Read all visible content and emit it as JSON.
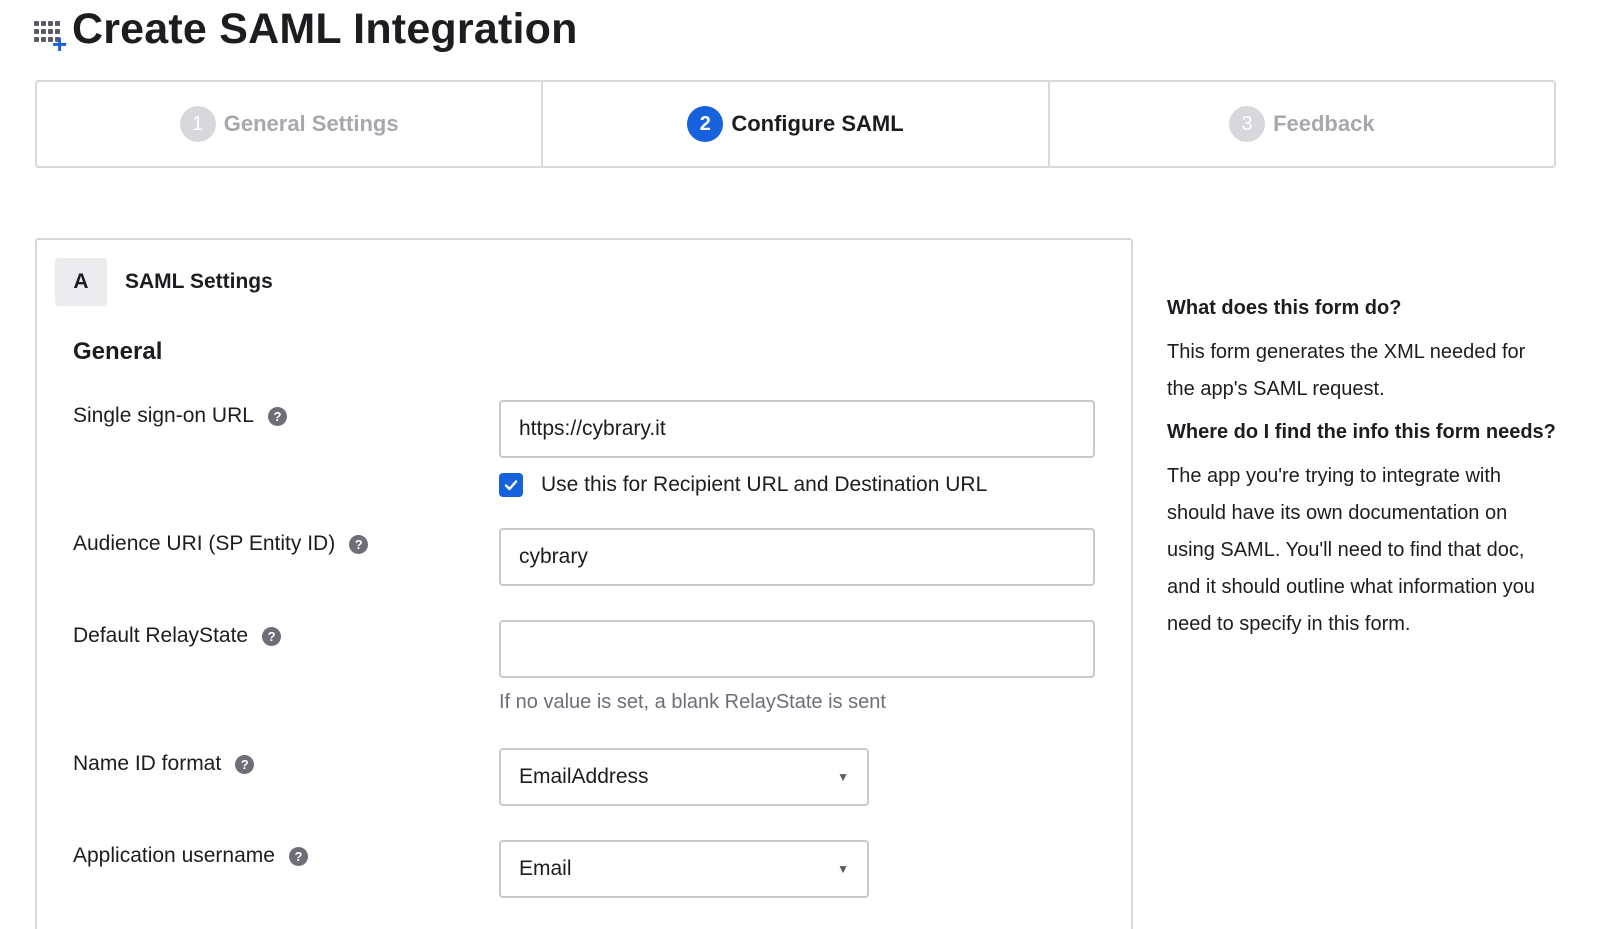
{
  "header": {
    "icon": "app-add-icon",
    "title": "Create SAML Integration"
  },
  "stepper": {
    "steps": [
      {
        "number": "1",
        "label": "General Settings",
        "state": "inactive"
      },
      {
        "number": "2",
        "label": "Configure SAML",
        "state": "active"
      },
      {
        "number": "3",
        "label": "Feedback",
        "state": "inactive"
      }
    ]
  },
  "section": {
    "letter": "A",
    "title": "SAML Settings",
    "group_title": "General"
  },
  "fields": {
    "sso_url": {
      "label": "Single sign-on URL",
      "value": "https://cybrary.it"
    },
    "recipient_checkbox": {
      "label": "Use this for Recipient URL and Destination URL",
      "checked": true
    },
    "audience_uri": {
      "label": "Audience URI (SP Entity ID)",
      "value": "cybrary"
    },
    "relay_state": {
      "label": "Default RelayState",
      "value": "",
      "hint": "If no value is set, a blank RelayState is sent"
    },
    "name_id_format": {
      "label": "Name ID format",
      "value": "EmailAddress"
    },
    "app_username": {
      "label": "Application username",
      "value": "Email"
    }
  },
  "help_icon_glyph": "?",
  "aside": {
    "q1": "What does this form do?",
    "a1": "This form generates the XML needed for the app's SAML request.",
    "q2": "Where do I find the info this form needs?",
    "a2": "The app you're trying to integrate with should have its own documentation on using SAML. You'll need to find that doc, and it should outline what information you need to specify in this form."
  },
  "colors": {
    "accent": "#1662dd",
    "border": "#d7d7dc",
    "muted_text": "#6e6e78"
  }
}
